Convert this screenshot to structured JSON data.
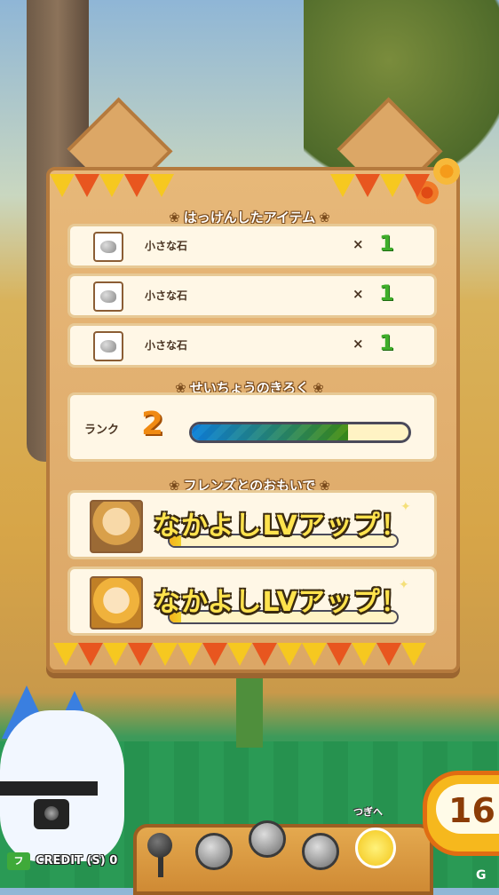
{
  "sections": {
    "items_title": "はっけんしたアイテム",
    "growth_title": "せいちょうのきろく",
    "friends_title": "フレンズとのおもいで"
  },
  "items": [
    {
      "name": "小さな石",
      "multiplier": "×",
      "qty": "1",
      "icon": "rock-icon"
    },
    {
      "name": "小さな石",
      "multiplier": "×",
      "qty": "1",
      "icon": "rock-icon"
    },
    {
      "name": "小さな石",
      "multiplier": "×",
      "qty": "1",
      "icon": "rock-icon"
    }
  ],
  "rank": {
    "label": "ランク",
    "value": "2",
    "progress": 0.72
  },
  "friends": [
    {
      "message": "なかよしLVアップ！",
      "portrait": "jaguar-portrait",
      "progress": 0.05
    },
    {
      "message": "なかよしLVアップ！",
      "portrait": "serval-portrait",
      "progress": 0.05
    }
  ],
  "hud": {
    "next_label": "つぎへ",
    "counter": "16",
    "credit": "CREDIT (S) 0",
    "credit_logo": "フ"
  },
  "colors": {
    "board": "#dca766",
    "bunting_yellow": "#f6c820",
    "bunting_orange": "#e8561f",
    "qty_green": "#3fae2a",
    "rank_orange": "#f08a12"
  }
}
